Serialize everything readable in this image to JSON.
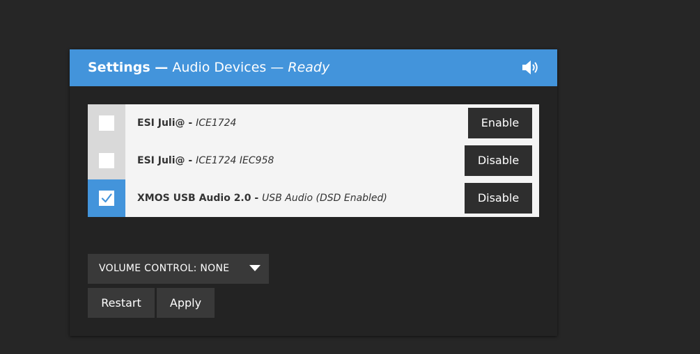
{
  "header": {
    "title": "Settings —",
    "subtitle": "Audio Devices —",
    "status": "Ready",
    "icon": "speaker-icon",
    "color": "#4394db"
  },
  "devices": [
    {
      "name": "ESI Juli@",
      "separator": " - ",
      "description": "ICE1724",
      "checked": false,
      "button_label": "Enable"
    },
    {
      "name": "ESI Juli@",
      "separator": " - ",
      "description": "ICE1724 IEC958",
      "checked": false,
      "button_label": "Disable"
    },
    {
      "name": "XMOS USB Audio 2.0",
      "separator": " - ",
      "description": "USB Audio (DSD Enabled)",
      "checked": true,
      "button_label": "Disable"
    }
  ],
  "volume_control": {
    "selected": "VOLUME CONTROL: NONE",
    "icon": "dropdown-arrow-icon"
  },
  "actions": {
    "restart_label": "Restart",
    "apply_label": "Apply"
  },
  "colors": {
    "accent": "#4394db",
    "background": "#262626",
    "panel": "#232323",
    "button": "#2e2e2e"
  }
}
